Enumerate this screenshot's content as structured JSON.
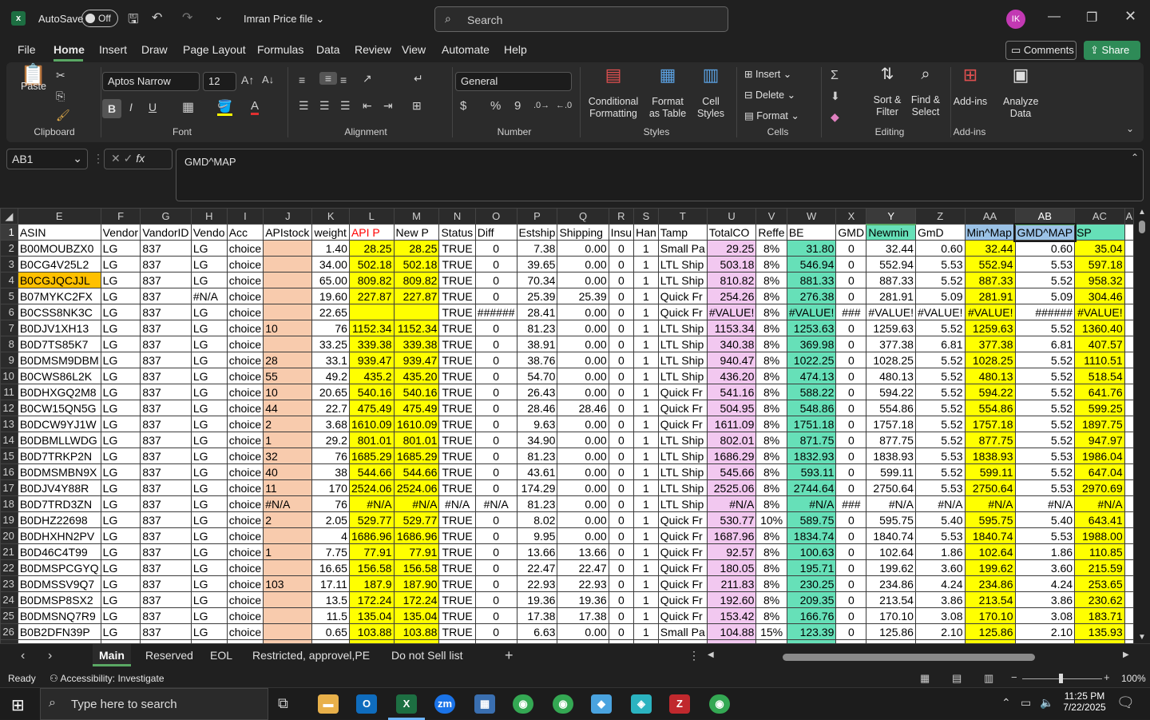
{
  "titlebar": {
    "autosave": "AutoSave",
    "toggle": "Off",
    "filename": "Imran Price file",
    "search": "Search",
    "avatar": "IK"
  },
  "menu": [
    "File",
    "Home",
    "Insert",
    "Draw",
    "Page Layout",
    "Formulas",
    "Data",
    "Review",
    "View",
    "Automate",
    "Help"
  ],
  "menu_right": {
    "comments": "Comments",
    "share": "Share"
  },
  "ribbon": {
    "paste": "Paste",
    "clipboard": "Clipboard",
    "font_name": "Aptos Narrow",
    "font_size": "12",
    "font": "Font",
    "alignment": "Alignment",
    "number_format": "General",
    "number": "Number",
    "cond_fmt": "Conditional Formatting",
    "fmt_table": "Format as Table",
    "cell_styles": "Cell Styles",
    "styles": "Styles",
    "insert": "Insert",
    "delete": "Delete",
    "format": "Format",
    "cells": "Cells",
    "sort": "Sort & Filter",
    "find": "Find & Select",
    "editing": "Editing",
    "addins": "Add-ins",
    "addins_grp": "Add-ins",
    "analyze": "Analyze Data"
  },
  "namebox": "AB1",
  "formula": "GMD^MAP",
  "columns": [
    "E",
    "F",
    "G",
    "H",
    "I",
    "J",
    "K",
    "L",
    "M",
    "N",
    "O",
    "P",
    "Q",
    "R",
    "S",
    "T",
    "U",
    "V",
    "W",
    "X",
    "Y",
    "Z",
    "AA",
    "AB",
    "AC",
    "A"
  ],
  "header": [
    "ASIN",
    "Vendor",
    "VandorID",
    "Vendo",
    "Acc",
    "APIstock",
    "weight",
    "API P",
    "New P",
    "Status",
    "Diff",
    "Estship",
    "Shipping",
    "Insu",
    "Han",
    "Tamp",
    "TotalCO",
    "Reffe",
    "BE",
    "GMD",
    "Newmin",
    "GmD",
    "Min^Map",
    "GMD^MAP",
    "SP",
    ""
  ],
  "rows": [
    [
      "B00MOUBZX0",
      "LG",
      "837",
      "LG",
      "choice",
      "",
      "1.40",
      "28.25",
      "28.25",
      "TRUE",
      "0",
      "7.38",
      "0.00",
      "0",
      "1",
      "Small Pa",
      "29.25",
      "8%",
      "31.80",
      "0",
      "32.44",
      "0.60",
      "32.44",
      "0.60",
      "35.04"
    ],
    [
      "B0CG4V25L2",
      "LG",
      "837",
      "LG",
      "choice",
      "",
      "34.00",
      "502.18",
      "502.18",
      "TRUE",
      "0",
      "39.65",
      "0.00",
      "0",
      "1",
      "LTL Ship",
      "503.18",
      "8%",
      "546.94",
      "0",
      "552.94",
      "5.53",
      "552.94",
      "5.53",
      "597.18"
    ],
    [
      "B0CGJQCJJL",
      "LG",
      "837",
      "LG",
      "choice",
      "",
      "65.00",
      "809.82",
      "809.82",
      "TRUE",
      "0",
      "70.34",
      "0.00",
      "0",
      "1",
      "LTL Ship",
      "810.82",
      "8%",
      "881.33",
      "0",
      "887.33",
      "5.52",
      "887.33",
      "5.52",
      "958.32"
    ],
    [
      "B07MYKC2FX",
      "LG",
      "837",
      "#N/A",
      "choice",
      "",
      "19.60",
      "227.87",
      "227.87",
      "TRUE",
      "0",
      "25.39",
      "25.39",
      "0",
      "1",
      "Quick Fr",
      "254.26",
      "8%",
      "276.38",
      "0",
      "281.91",
      "5.09",
      "281.91",
      "5.09",
      "304.46"
    ],
    [
      "B0CSS8NK3C",
      "LG",
      "837",
      "LG",
      "choice",
      "",
      "22.65",
      "",
      "",
      "TRUE",
      "######",
      "28.41",
      "0.00",
      "0",
      "1",
      "Quick Fr",
      "#VALUE!",
      "8%",
      "#VALUE!",
      "###",
      "#VALUE!",
      "#VALUE!",
      "#VALUE!",
      "######",
      "#VALUE!"
    ],
    [
      "B0DJV1XH13",
      "LG",
      "837",
      "LG",
      "choice",
      "10",
      "76",
      "1152.34",
      "1152.34",
      "TRUE",
      "0",
      "81.23",
      "0.00",
      "0",
      "1",
      "LTL Ship",
      "1153.34",
      "8%",
      "1253.63",
      "0",
      "1259.63",
      "5.52",
      "1259.63",
      "5.52",
      "1360.40"
    ],
    [
      "B0D7TS85K7",
      "LG",
      "837",
      "LG",
      "choice",
      "",
      "33.25",
      "339.38",
      "339.38",
      "TRUE",
      "0",
      "38.91",
      "0.00",
      "0",
      "1",
      "LTL Ship",
      "340.38",
      "8%",
      "369.98",
      "0",
      "377.38",
      "6.81",
      "377.38",
      "6.81",
      "407.57"
    ],
    [
      "B0DMSM9DBM",
      "LG",
      "837",
      "LG",
      "choice",
      "28",
      "33.1",
      "939.47",
      "939.47",
      "TRUE",
      "0",
      "38.76",
      "0.00",
      "0",
      "1",
      "LTL Ship",
      "940.47",
      "8%",
      "1022.25",
      "0",
      "1028.25",
      "5.52",
      "1028.25",
      "5.52",
      "1110.51"
    ],
    [
      "B0CWS86L2K",
      "LG",
      "837",
      "LG",
      "choice",
      "55",
      "49.2",
      "435.2",
      "435.20",
      "TRUE",
      "0",
      "54.70",
      "0.00",
      "0",
      "1",
      "LTL Ship",
      "436.20",
      "8%",
      "474.13",
      "0",
      "480.13",
      "5.52",
      "480.13",
      "5.52",
      "518.54"
    ],
    [
      "B0DHXGQ2M8",
      "LG",
      "837",
      "LG",
      "choice",
      "10",
      "20.65",
      "540.16",
      "540.16",
      "TRUE",
      "0",
      "26.43",
      "0.00",
      "0",
      "1",
      "Quick Fr",
      "541.16",
      "8%",
      "588.22",
      "0",
      "594.22",
      "5.52",
      "594.22",
      "5.52",
      "641.76"
    ],
    [
      "B0CW15QN5G",
      "LG",
      "837",
      "LG",
      "choice",
      "44",
      "22.7",
      "475.49",
      "475.49",
      "TRUE",
      "0",
      "28.46",
      "28.46",
      "0",
      "1",
      "Quick Fr",
      "504.95",
      "8%",
      "548.86",
      "0",
      "554.86",
      "5.52",
      "554.86",
      "5.52",
      "599.25"
    ],
    [
      "B0DCW9YJ1W",
      "LG",
      "837",
      "LG",
      "choice",
      "2",
      "3.68",
      "1610.09",
      "1610.09",
      "TRUE",
      "0",
      "9.63",
      "0.00",
      "0",
      "1",
      "Quick Fr",
      "1611.09",
      "8%",
      "1751.18",
      "0",
      "1757.18",
      "5.52",
      "1757.18",
      "5.52",
      "1897.75"
    ],
    [
      "B0DBMLLWDG",
      "LG",
      "837",
      "LG",
      "choice",
      "1",
      "29.2",
      "801.01",
      "801.01",
      "TRUE",
      "0",
      "34.90",
      "0.00",
      "0",
      "1",
      "LTL Ship",
      "802.01",
      "8%",
      "871.75",
      "0",
      "877.75",
      "5.52",
      "877.75",
      "5.52",
      "947.97"
    ],
    [
      "B0D7TRKP2N",
      "LG",
      "837",
      "LG",
      "choice",
      "32",
      "76",
      "1685.29",
      "1685.29",
      "TRUE",
      "0",
      "81.23",
      "0.00",
      "0",
      "1",
      "LTL Ship",
      "1686.29",
      "8%",
      "1832.93",
      "0",
      "1838.93",
      "5.53",
      "1838.93",
      "5.53",
      "1986.04"
    ],
    [
      "B0DMSMBN9X",
      "LG",
      "837",
      "LG",
      "choice",
      "40",
      "38",
      "544.66",
      "544.66",
      "TRUE",
      "0",
      "43.61",
      "0.00",
      "0",
      "1",
      "LTL Ship",
      "545.66",
      "8%",
      "593.11",
      "0",
      "599.11",
      "5.52",
      "599.11",
      "5.52",
      "647.04"
    ],
    [
      "B0DJV4Y88R",
      "LG",
      "837",
      "LG",
      "choice",
      "11",
      "170",
      "2524.06",
      "2524.06",
      "TRUE",
      "0",
      "174.29",
      "0.00",
      "0",
      "1",
      "LTL Ship",
      "2525.06",
      "8%",
      "2744.64",
      "0",
      "2750.64",
      "5.53",
      "2750.64",
      "5.53",
      "2970.69"
    ],
    [
      "B0D7TRD3ZN",
      "LG",
      "837",
      "LG",
      "choice",
      "#N/A",
      "76",
      "#N/A",
      "#N/A",
      "#N/A",
      "#N/A",
      "81.23",
      "0.00",
      "0",
      "1",
      "LTL Ship",
      "#N/A",
      "8%",
      "#N/A",
      "###",
      "#N/A",
      "#N/A",
      "#N/A",
      "#N/A",
      "#N/A"
    ],
    [
      "B0DHZ22698",
      "LG",
      "837",
      "LG",
      "choice",
      "2",
      "2.05",
      "529.77",
      "529.77",
      "TRUE",
      "0",
      "8.02",
      "0.00",
      "0",
      "1",
      "Quick Fr",
      "530.77",
      "10%",
      "589.75",
      "0",
      "595.75",
      "5.40",
      "595.75",
      "5.40",
      "643.41"
    ],
    [
      "B0DHXHN2PV",
      "LG",
      "837",
      "LG",
      "choice",
      "",
      "4",
      "1686.96",
      "1686.96",
      "TRUE",
      "0",
      "9.95",
      "0.00",
      "0",
      "1",
      "Quick Fr",
      "1687.96",
      "8%",
      "1834.74",
      "0",
      "1840.74",
      "5.53",
      "1840.74",
      "5.53",
      "1988.00"
    ],
    [
      "B0D46C4T99",
      "LG",
      "837",
      "LG",
      "choice",
      "1",
      "7.75",
      "77.91",
      "77.91",
      "TRUE",
      "0",
      "13.66",
      "13.66",
      "0",
      "1",
      "Quick Fr",
      "92.57",
      "8%",
      "100.63",
      "0",
      "102.64",
      "1.86",
      "102.64",
      "1.86",
      "110.85"
    ],
    [
      "B0DMSPCGYQ",
      "LG",
      "837",
      "LG",
      "choice",
      "",
      "16.65",
      "156.58",
      "156.58",
      "TRUE",
      "0",
      "22.47",
      "22.47",
      "0",
      "1",
      "Quick Fr",
      "180.05",
      "8%",
      "195.71",
      "0",
      "199.62",
      "3.60",
      "199.62",
      "3.60",
      "215.59"
    ],
    [
      "B0DMSSV9Q7",
      "LG",
      "837",
      "LG",
      "choice",
      "103",
      "17.11",
      "187.9",
      "187.90",
      "TRUE",
      "0",
      "22.93",
      "22.93",
      "0",
      "1",
      "Quick Fr",
      "211.83",
      "8%",
      "230.25",
      "0",
      "234.86",
      "4.24",
      "234.86",
      "4.24",
      "253.65"
    ],
    [
      "B0DMSP8SX2",
      "LG",
      "837",
      "LG",
      "choice",
      "",
      "13.5",
      "172.24",
      "172.24",
      "TRUE",
      "0",
      "19.36",
      "19.36",
      "0",
      "1",
      "Quick Fr",
      "192.60",
      "8%",
      "209.35",
      "0",
      "213.54",
      "3.86",
      "213.54",
      "3.86",
      "230.62"
    ],
    [
      "B0DMSNQ7R9",
      "LG",
      "837",
      "LG",
      "choice",
      "",
      "11.5",
      "135.04",
      "135.04",
      "TRUE",
      "0",
      "17.38",
      "17.38",
      "0",
      "1",
      "Quick Fr",
      "153.42",
      "8%",
      "166.76",
      "0",
      "170.10",
      "3.08",
      "170.10",
      "3.08",
      "183.71"
    ],
    [
      "B0B2DFN39P",
      "LG",
      "837",
      "LG",
      "choice",
      "",
      "0.65",
      "103.88",
      "103.88",
      "TRUE",
      "0",
      "6.63",
      "0.00",
      "0",
      "1",
      "Small Pa",
      "104.88",
      "15%",
      "123.39",
      "0",
      "125.86",
      "2.10",
      "125.86",
      "2.10",
      "135.93"
    ]
  ],
  "sheets": [
    "Main",
    "Reserved",
    "EOL",
    "Restricted, approvel,PE",
    "Do not Sell list"
  ],
  "status": {
    "ready": "Ready",
    "access": "Accessibility: Investigate",
    "zoom": "100%"
  },
  "taskbar": {
    "search": "Type here to search",
    "time": "11:25 PM",
    "date": "7/22/2025"
  }
}
